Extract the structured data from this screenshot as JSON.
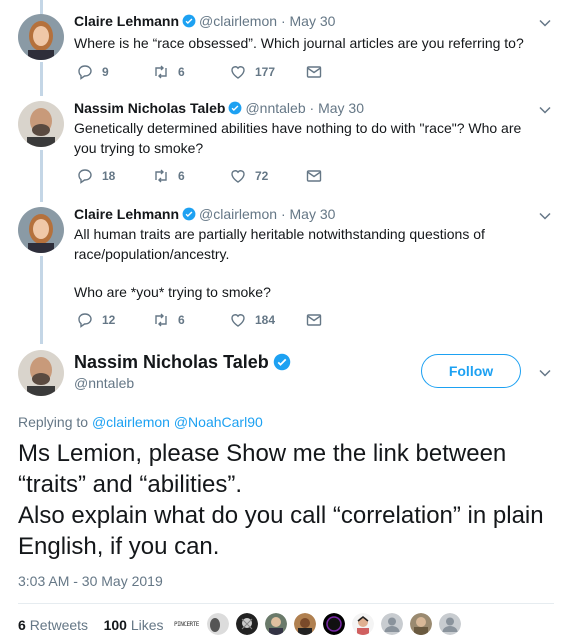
{
  "tweets": [
    {
      "name": "Claire Lehmann",
      "handle": "@clairlemon",
      "separator": "·",
      "date": "May 30",
      "text": "Where is he “race obsessed”. Which journal articles are you referring to?",
      "replies": "9",
      "retweets": "6",
      "likes": "177"
    },
    {
      "name": "Nassim Nicholas Taleb",
      "handle": "@nntaleb",
      "separator": "·",
      "date": "May 30",
      "text": "Genetically determined abilities have nothing to do with \"race\"? Who are you trying to smoke?",
      "replies": "18",
      "retweets": "6",
      "likes": "72"
    },
    {
      "name": "Claire Lehmann",
      "handle": "@clairlemon",
      "separator": "·",
      "date": "May 30",
      "text_line1": "All human traits are partially heritable notwithstanding questions of race/population/ancestry.",
      "text_line2": "Who are *you* trying to smoke?",
      "replies": "12",
      "retweets": "6",
      "likes": "184"
    }
  ],
  "main": {
    "name": "Nassim Nicholas Taleb",
    "handle": "@nntaleb",
    "follow_label": "Follow",
    "replying_prefix": "Replying to",
    "replying_to": [
      "@clairlemon",
      "@NoahCarl90"
    ],
    "text_line1": "Ms Lemion, please Show me the link between “traits” and “abilities”.",
    "text_line2": "Also explain what do you call “correlation” in plain English, if you can.",
    "timestamp": "3:03 AM - 30 May 2019",
    "retweet_count": "6",
    "retweet_label": "Retweets",
    "like_count": "100",
    "like_label": "Likes",
    "liker_tag": "PINCERTE"
  },
  "icons": [
    "reply-icon",
    "retweet-icon",
    "like-icon",
    "dm-icon",
    "verified-icon",
    "caret-down-icon"
  ],
  "colors": {
    "accent": "#1da1f2",
    "muted": "#657786",
    "thread_line": "#c4d6e6",
    "text": "#14171a"
  }
}
